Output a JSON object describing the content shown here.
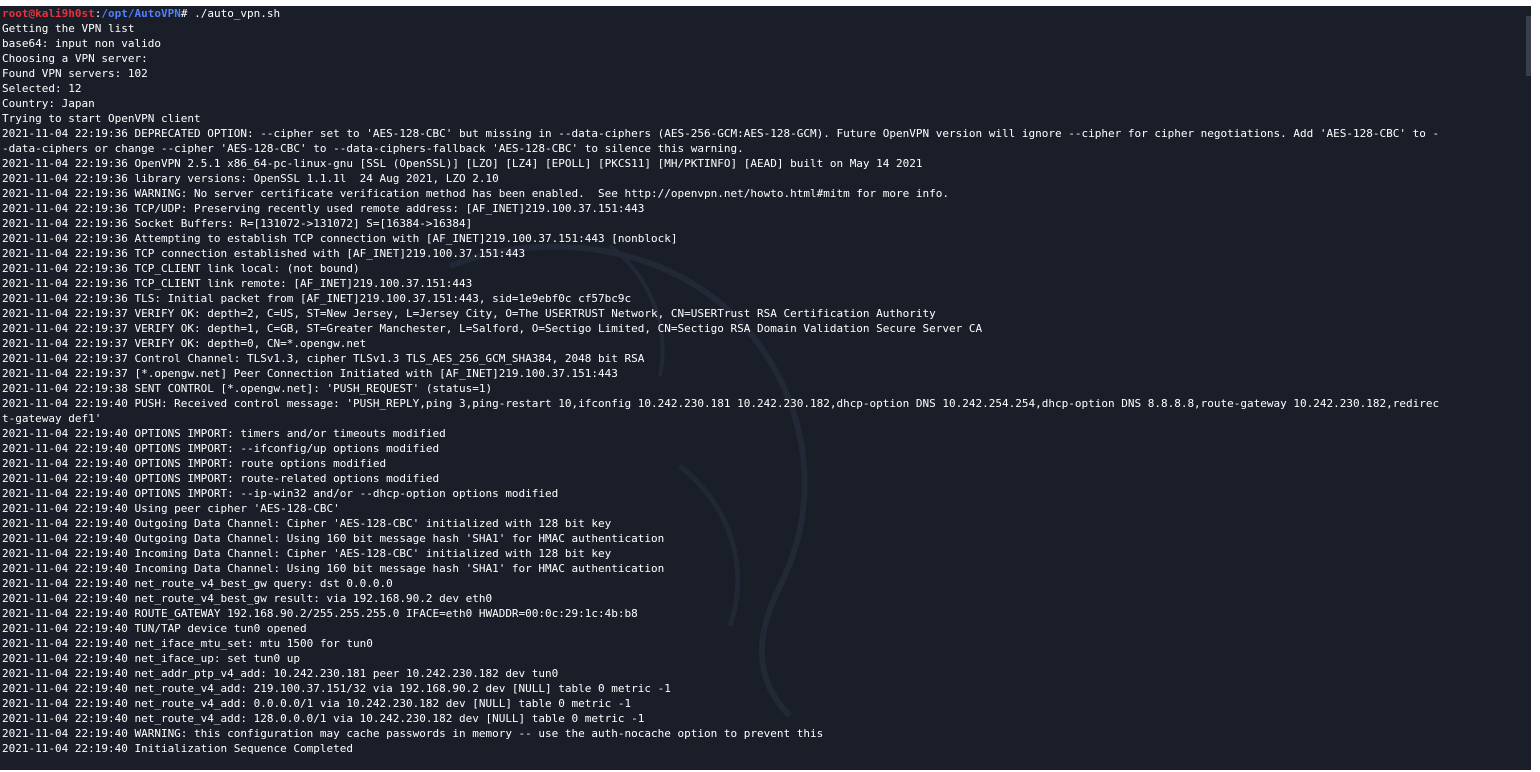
{
  "prompt": {
    "user_host": "root@kali9h0st",
    "separator": ":",
    "path": "/opt/AutoVPN",
    "symbol": "#",
    "command": " ./auto_vpn.sh"
  },
  "output": [
    "Getting the VPN list",
    "base64: input non valido",
    "Choosing a VPN server:",
    "Found VPN servers: 102",
    "Selected: 12",
    "Country: Japan",
    "Trying to start OpenVPN client",
    "2021-11-04 22:19:36 DEPRECATED OPTION: --cipher set to 'AES-128-CBC' but missing in --data-ciphers (AES-256-GCM:AES-128-GCM). Future OpenVPN version will ignore --cipher for cipher negotiations. Add 'AES-128-CBC' to -",
    "-data-ciphers or change --cipher 'AES-128-CBC' to --data-ciphers-fallback 'AES-128-CBC' to silence this warning.",
    "2021-11-04 22:19:36 OpenVPN 2.5.1 x86_64-pc-linux-gnu [SSL (OpenSSL)] [LZO] [LZ4] [EPOLL] [PKCS11] [MH/PKTINFO] [AEAD] built on May 14 2021",
    "2021-11-04 22:19:36 library versions: OpenSSL 1.1.1l  24 Aug 2021, LZO 2.10",
    "2021-11-04 22:19:36 WARNING: No server certificate verification method has been enabled.  See http://openvpn.net/howto.html#mitm for more info.",
    "2021-11-04 22:19:36 TCP/UDP: Preserving recently used remote address: [AF_INET]219.100.37.151:443",
    "2021-11-04 22:19:36 Socket Buffers: R=[131072->131072] S=[16384->16384]",
    "2021-11-04 22:19:36 Attempting to establish TCP connection with [AF_INET]219.100.37.151:443 [nonblock]",
    "2021-11-04 22:19:36 TCP connection established with [AF_INET]219.100.37.151:443",
    "2021-11-04 22:19:36 TCP_CLIENT link local: (not bound)",
    "2021-11-04 22:19:36 TCP_CLIENT link remote: [AF_INET]219.100.37.151:443",
    "2021-11-04 22:19:36 TLS: Initial packet from [AF_INET]219.100.37.151:443, sid=1e9ebf0c cf57bc9c",
    "2021-11-04 22:19:37 VERIFY OK: depth=2, C=US, ST=New Jersey, L=Jersey City, O=The USERTRUST Network, CN=USERTrust RSA Certification Authority",
    "2021-11-04 22:19:37 VERIFY OK: depth=1, C=GB, ST=Greater Manchester, L=Salford, O=Sectigo Limited, CN=Sectigo RSA Domain Validation Secure Server CA",
    "2021-11-04 22:19:37 VERIFY OK: depth=0, CN=*.opengw.net",
    "2021-11-04 22:19:37 Control Channel: TLSv1.3, cipher TLSv1.3 TLS_AES_256_GCM_SHA384, 2048 bit RSA",
    "2021-11-04 22:19:37 [*.opengw.net] Peer Connection Initiated with [AF_INET]219.100.37.151:443",
    "2021-11-04 22:19:38 SENT CONTROL [*.opengw.net]: 'PUSH_REQUEST' (status=1)",
    "2021-11-04 22:19:40 PUSH: Received control message: 'PUSH_REPLY,ping 3,ping-restart 10,ifconfig 10.242.230.181 10.242.230.182,dhcp-option DNS 10.242.254.254,dhcp-option DNS 8.8.8.8,route-gateway 10.242.230.182,redirec",
    "t-gateway def1'",
    "2021-11-04 22:19:40 OPTIONS IMPORT: timers and/or timeouts modified",
    "2021-11-04 22:19:40 OPTIONS IMPORT: --ifconfig/up options modified",
    "2021-11-04 22:19:40 OPTIONS IMPORT: route options modified",
    "2021-11-04 22:19:40 OPTIONS IMPORT: route-related options modified",
    "2021-11-04 22:19:40 OPTIONS IMPORT: --ip-win32 and/or --dhcp-option options modified",
    "2021-11-04 22:19:40 Using peer cipher 'AES-128-CBC'",
    "2021-11-04 22:19:40 Outgoing Data Channel: Cipher 'AES-128-CBC' initialized with 128 bit key",
    "2021-11-04 22:19:40 Outgoing Data Channel: Using 160 bit message hash 'SHA1' for HMAC authentication",
    "2021-11-04 22:19:40 Incoming Data Channel: Cipher 'AES-128-CBC' initialized with 128 bit key",
    "2021-11-04 22:19:40 Incoming Data Channel: Using 160 bit message hash 'SHA1' for HMAC authentication",
    "2021-11-04 22:19:40 net_route_v4_best_gw query: dst 0.0.0.0",
    "2021-11-04 22:19:40 net_route_v4_best_gw result: via 192.168.90.2 dev eth0",
    "2021-11-04 22:19:40 ROUTE_GATEWAY 192.168.90.2/255.255.255.0 IFACE=eth0 HWADDR=00:0c:29:1c:4b:b8",
    "2021-11-04 22:19:40 TUN/TAP device tun0 opened",
    "2021-11-04 22:19:40 net_iface_mtu_set: mtu 1500 for tun0",
    "2021-11-04 22:19:40 net_iface_up: set tun0 up",
    "2021-11-04 22:19:40 net_addr_ptp_v4_add: 10.242.230.181 peer 10.242.230.182 dev tun0",
    "2021-11-04 22:19:40 net_route_v4_add: 219.100.37.151/32 via 192.168.90.2 dev [NULL] table 0 metric -1",
    "2021-11-04 22:19:40 net_route_v4_add: 0.0.0.0/1 via 10.242.230.182 dev [NULL] table 0 metric -1",
    "2021-11-04 22:19:40 net_route_v4_add: 128.0.0.0/1 via 10.242.230.182 dev [NULL] table 0 metric -1",
    "2021-11-04 22:19:40 WARNING: this configuration may cache passwords in memory -- use the auth-nocache option to prevent this",
    "2021-11-04 22:19:40 Initialization Sequence Completed"
  ],
  "colors": {
    "background": "#1a1e29",
    "text": "#ffffff",
    "prompt_user": "#e6323e",
    "prompt_path": "#4f7fff"
  }
}
